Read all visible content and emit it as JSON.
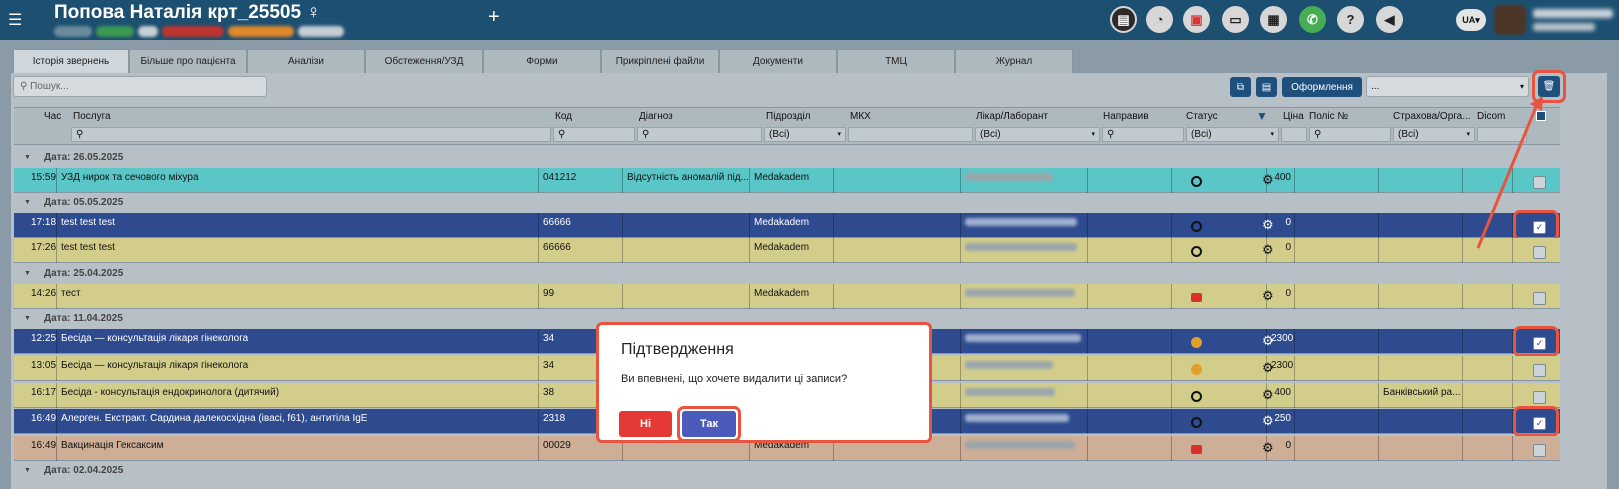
{
  "header": {
    "menu_icon": "☰",
    "title": "Попова Наталія крт_25505 ♀",
    "plus": "+",
    "lang": "UA▾"
  },
  "tabs": [
    "Історія звернень",
    "Більше про пацієнта",
    "Аналізи",
    "Обстеження/УЗД",
    "Форми",
    "Прикріплені файли",
    "Документи",
    "ТМЦ",
    "Журнал"
  ],
  "toolbar": {
    "search_placeholder": "Пошук...",
    "format_label": "Оформлення",
    "select_value": "...",
    "select_caret": "▾"
  },
  "columns": [
    "Час",
    "Послуга",
    "Код",
    "Діагноз",
    "Підрозділ",
    "МКХ",
    "Лікар/Лаборант",
    "Направив",
    "Статус",
    "Ціна",
    "Поліс №",
    "Страхова/Орга...",
    "Dicom"
  ],
  "filters": {
    "dept": "(Всі)",
    "doctor": "(Всі)",
    "status": "(Всі)",
    "insurer": "(Всі)",
    "caret": "▾"
  },
  "groups": [
    "Дата: 26.05.2025",
    "Дата: 05.05.2025",
    "Дата: 25.04.2025",
    "Дата: 11.04.2025",
    "Дата: 02.04.2025"
  ],
  "rows": [
    {
      "time": "15:59",
      "service": "УЗД нирок та сечового міхура",
      "code": "041212",
      "diagnosis": "Відсутність аномалій під...",
      "dept": "Medakadem",
      "price": "400",
      "insurer": "",
      "checked": false,
      "status": "circle",
      "bg": "#5bc6c7",
      "tx": "#111"
    },
    {
      "time": "17:18",
      "service": "test test test",
      "code": "66666",
      "diagnosis": "",
      "dept": "Medakadem",
      "price": "0",
      "insurer": "",
      "checked": true,
      "status": "circle",
      "bg": "#2e4b8f",
      "tx": "#fff"
    },
    {
      "time": "17:26",
      "service": "test test test",
      "code": "66666",
      "diagnosis": "",
      "dept": "Medakadem",
      "price": "0",
      "insurer": "",
      "checked": false,
      "status": "circle",
      "bg": "#d3cd8c",
      "tx": "#111"
    },
    {
      "time": "14:26",
      "service": "тест",
      "code": "99",
      "diagnosis": "",
      "dept": "Medakadem",
      "price": "0",
      "insurer": "",
      "checked": false,
      "status": "printer",
      "bg": "#d3cd8c",
      "tx": "#111"
    },
    {
      "time": "12:25",
      "service": "Бесіда — консультація  лікаря гінеколога",
      "code": "34",
      "diagnosis": "",
      "dept": "",
      "price": "2300",
      "insurer": "",
      "checked": true,
      "status": "orange",
      "bg": "#2e4b8f",
      "tx": "#fff"
    },
    {
      "time": "13:05",
      "service": "Бесіда — консультація  лікаря гінеколога",
      "code": "34",
      "diagnosis": "",
      "dept": "",
      "price": "2300",
      "insurer": "",
      "checked": false,
      "status": "orange",
      "bg": "#d3cd8c",
      "tx": "#111"
    },
    {
      "time": "16:17",
      "service": "Бесіда - консультація ендокринолога (дитячий)",
      "code": "38",
      "diagnosis": "",
      "dept": "",
      "price": "400",
      "insurer": "Банківський ра...",
      "checked": false,
      "status": "circle",
      "bg": "#d3cd8c",
      "tx": "#111"
    },
    {
      "time": "16:49",
      "service": "Алерген. Екстракт. Сардина далекосхідна (івасі, f61), антитіла IgE",
      "code": "2318",
      "diagnosis": "",
      "dept": "",
      "price": "250",
      "insurer": "",
      "checked": true,
      "status": "circle",
      "bg": "#2e4b8f",
      "tx": "#fff"
    },
    {
      "time": "16:49",
      "service": "Вакцинація Гексаксим",
      "code": "00029",
      "diagnosis": "",
      "dept": "Medakadem",
      "price": "0",
      "insurer": "",
      "checked": false,
      "status": "printer",
      "bg": "#cfae97",
      "tx": "#111"
    }
  ],
  "modal": {
    "title": "Підтвердження",
    "message": "Ви впевнені, що хочете видалити ці записи?",
    "no": "Ні",
    "yes": "Так"
  }
}
